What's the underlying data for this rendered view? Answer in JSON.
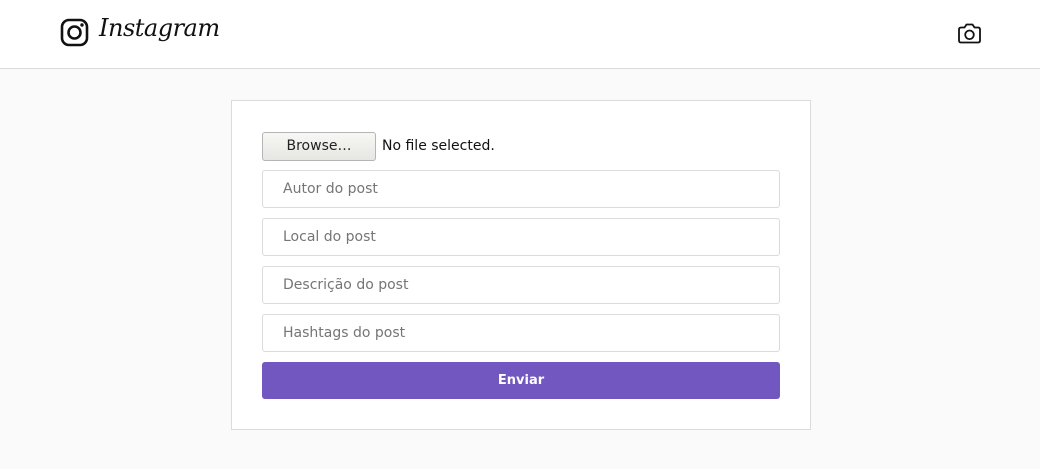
{
  "header": {
    "brand": "Instagram",
    "logo_icon": "instagram-logo-icon",
    "camera_icon": "camera-icon"
  },
  "form": {
    "file_button_label": "Browse…",
    "file_status": "No file selected.",
    "author_placeholder": "Autor do post",
    "location_placeholder": "Local do post",
    "description_placeholder": "Descrição do post",
    "hashtags_placeholder": "Hashtags do post",
    "submit_label": "Enviar"
  },
  "colors": {
    "accent": "#7157bf",
    "page_background": "#fafafa",
    "border": "#dbdbdb"
  }
}
